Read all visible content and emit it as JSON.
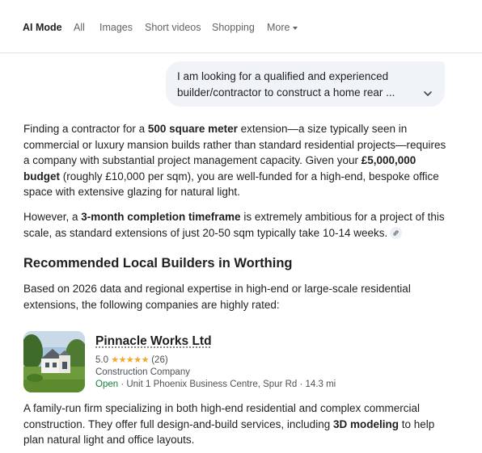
{
  "tabs": [
    {
      "label": "AI Mode",
      "active": true
    },
    {
      "label": "All",
      "active": false
    },
    {
      "label": "Images",
      "active": false
    },
    {
      "label": "Short videos",
      "active": false
    },
    {
      "label": "Shopping",
      "active": false
    },
    {
      "label": "More",
      "active": false
    }
  ],
  "query": {
    "line1": "I am looking for a qualified and experienced",
    "line2": "builder/contractor to construct a home rear ..."
  },
  "para1": {
    "t1": "Finding a contractor for a ",
    "b1": "500 square meter",
    "t2": " extension—a size typically seen in commercial or luxury mansion builds rather than standard residential projects—requires a company with substantial project management capacity. Given your ",
    "b2": "£5,000,000 budget",
    "t3": " (roughly £10,000 per sqm), you are well-funded for a high-end, bespoke office space with extensive glazing for natural light."
  },
  "para2": {
    "t1": "However, a ",
    "b1": "3-month completion timeframe",
    "t2": " is extremely ambitious for a project of this scale, as standard extensions of just 20-50 sqm typically take 10-14 weeks."
  },
  "heading": "Recommended Local Builders in Worthing",
  "para3": "Based on 2026 data and regional expertise in high-end or large-scale residential extensions, the following companies are highly rated:",
  "business": {
    "name": "Pinnacle Works Ltd",
    "rating": "5.0",
    "stars": "★★★★★",
    "reviews": "(26)",
    "category": "Construction Company",
    "status": "Open",
    "address": " · Unit 1 Phoenix Business Centre, Spur Rd · 14.3 mi",
    "status_color": "#188038",
    "star_color": "#f5a623"
  },
  "para4": {
    "t1": "A family-run firm specializing in both high-end residential and complex commercial construction. They offer full design-and-build services, including ",
    "b1": "3D modeling",
    "t2": " to help plan natural light and office layouts."
  }
}
